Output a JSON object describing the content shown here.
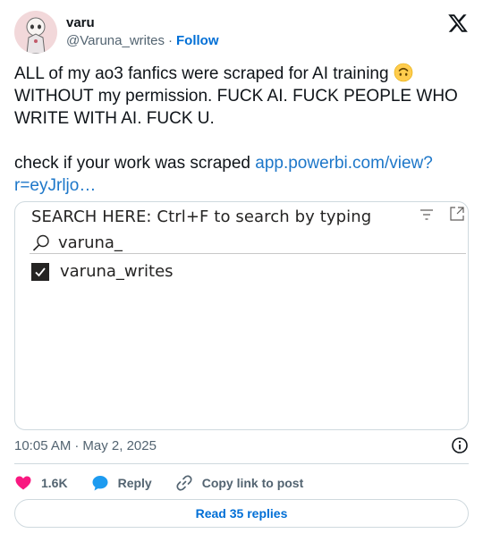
{
  "author": {
    "display_name": "varu",
    "handle": "@Varuna_writes",
    "separator": "·",
    "follow_label": "Follow",
    "avatar_icon": "cartoon-avatar",
    "platform_icon": "x-logo-icon"
  },
  "tweet": {
    "text_line1": "ALL of my ao3 fanfics were scraped for AI training ",
    "emoji_icon": "upside-down-face-emoji",
    "text_rest": "WITHOUT my permission. FUCK AI. FUCK PEOPLE WHO WRITE WITH AI. FUCK U.",
    "text_check": "check if your work was scraped ",
    "link_text": "app.powerbi.com/view?r=eyJrljo…"
  },
  "media": {
    "title": "SEARCH HERE: Ctrl+F to search by typing",
    "search_value": "varuna_",
    "checkbox_label": "varuna_writes",
    "checkbox_checked": true
  },
  "meta": {
    "time": "10:05 AM",
    "separator": "·",
    "date": "May 2, 2025"
  },
  "actions": {
    "likes_count": "1.6K",
    "reply_label": "Reply",
    "copy_label": "Copy link to post"
  },
  "read_replies_label": "Read 35 replies",
  "colors": {
    "accent": "#006fd6",
    "link": "#1d77c9",
    "like": "#f91880",
    "reply_icon": "#1d9bf0",
    "muted": "#536471",
    "border": "#cfd9de"
  }
}
